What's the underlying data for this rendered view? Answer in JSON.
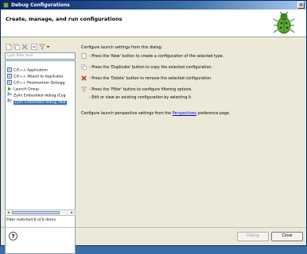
{
  "window": {
    "title": "Debug Configurations",
    "close_glyph": "✕"
  },
  "header": {
    "title": "Create, manage, and run configurations",
    "icon": "debug-bug-icon"
  },
  "toolbar": {
    "buttons": [
      {
        "name": "new-config-icon"
      },
      {
        "name": "duplicate-config-icon"
      },
      {
        "name": "delete-config-icon"
      },
      {
        "name": "collapse-all-icon"
      },
      {
        "name": "filter-icon"
      },
      {
        "name": "view-menu-chevron-icon"
      }
    ]
  },
  "filter": {
    "placeholder": "type filter text"
  },
  "tree": {
    "items": [
      {
        "label": "C/C++ Application",
        "icon": "c-app-icon",
        "level": 1
      },
      {
        "label": "C/C++ Attach to Applicatio",
        "icon": "c-app-icon",
        "level": 1
      },
      {
        "label": "C/C++ Postmortem Debugg",
        "icon": "c-app-icon",
        "level": 1
      },
      {
        "label": "Launch Group",
        "icon": "launch-group-icon",
        "level": 1
      },
      {
        "label": "Zylin Embedded debug (Cyg",
        "icon": "zylin-icon",
        "level": 1
      },
      {
        "label": "Zylin Embedded debug (Nat",
        "icon": "zylin-icon",
        "level": 1,
        "selected": true
      }
    ]
  },
  "filter_status": "Filter matched 6 of 6 items",
  "right": {
    "intro": "Configure launch settings from this dialog:",
    "lines": [
      {
        "icon": "new-config-icon",
        "text": "- Press the 'New' button to create a configuration of the selected type."
      },
      {
        "icon": "duplicate-config-icon",
        "text": "- Press the 'Duplicate' button to copy the selected configuration."
      },
      {
        "icon": "delete-config-icon",
        "text": "- Press the 'Delete' button to remove the selected configuration."
      },
      {
        "icon": "filter-icon",
        "text": "- Press the 'Filter' button to configure filtering options."
      },
      {
        "icon": "",
        "text": "- Edit or view an existing configuration by selecting it."
      }
    ],
    "perspective_prefix": "Configure launch perspective settings from the ",
    "perspective_link": "Perspectives",
    "perspective_suffix": " preference page."
  },
  "buttons": {
    "help": "?",
    "debug": "Debug",
    "close": "Close"
  }
}
